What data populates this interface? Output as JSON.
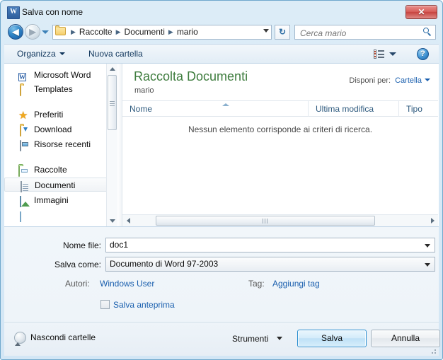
{
  "window": {
    "title": "Salva con nome",
    "app_icon": "W",
    "close_label": "✕"
  },
  "navigation": {
    "back_icon": "◀",
    "forward_icon": "▶",
    "history_icon": "chevron-down-icon",
    "breadcrumbs": [
      "Raccolte",
      "Documenti",
      "mario"
    ],
    "separator": "▶",
    "refresh_icon": "↻",
    "search": {
      "placeholder": "Cerca mario",
      "value": ""
    }
  },
  "commandbar": {
    "organizza": "Organizza",
    "nuova_cartella": "Nuova cartella",
    "view_icon": "view-list-icon",
    "help_icon": "?"
  },
  "sidebar": {
    "items": [
      {
        "label": "Microsoft Word",
        "icon": "word-icon",
        "level": 0,
        "selected": false
      },
      {
        "label": "Templates",
        "icon": "folder-icon",
        "level": 1,
        "selected": false
      },
      {
        "label": "Preferiti",
        "icon": "star-icon",
        "level": 0,
        "selected": false
      },
      {
        "label": "Download",
        "icon": "download-icon",
        "level": 1,
        "selected": false
      },
      {
        "label": "Risorse recenti",
        "icon": "computer-icon",
        "level": 1,
        "selected": false
      },
      {
        "label": "Raccolte",
        "icon": "library-icon",
        "level": 0,
        "selected": false
      },
      {
        "label": "Documenti",
        "icon": "document-icon",
        "level": 1,
        "selected": true
      },
      {
        "label": "Immagini",
        "icon": "picture-icon",
        "level": 1,
        "selected": false
      }
    ]
  },
  "list": {
    "library_title": "Raccolta Documenti",
    "library_subtitle": "mario",
    "arrange_label": "Disponi per:",
    "arrange_value": "Cartella",
    "columns": [
      "Nome",
      "Ultima modifica",
      "Tipo"
    ],
    "rows": [],
    "empty_message": "Nessun elemento corrisponde ai criteri di ricerca."
  },
  "form": {
    "filename_label": "Nome file:",
    "filename_value": "doc1",
    "filetype_label": "Salva come:",
    "filetype_value": "Documento di Word 97-2003",
    "authors_label": "Autori:",
    "authors_value": "Windows User",
    "tags_label": "Tag:",
    "tags_value": "Aggiungi tag",
    "thumbnail_checkbox_label": "Salva anteprima",
    "thumbnail_checked": false
  },
  "footer": {
    "hide_folders_label": "Nascondi cartelle",
    "tools_label": "Strumenti",
    "save_label": "Salva",
    "cancel_label": "Annulla"
  },
  "colors": {
    "accent": "#2c8fd0",
    "link": "#1a5fae",
    "library_title": "#3f7d3f",
    "window_frame": "#6fa8cd"
  }
}
